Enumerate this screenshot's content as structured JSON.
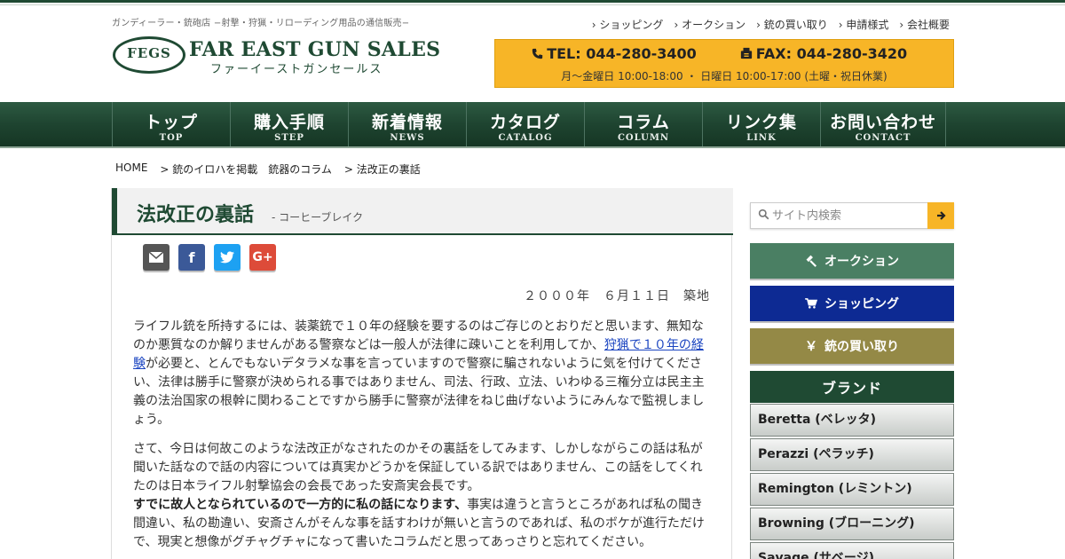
{
  "header": {
    "tagline": "ガンディーラー・銃砲店 −射撃・狩猟・リローディング用品の通信販売−",
    "logo_emblem": "FEGS",
    "logo_en": "FAR EAST GUN SALES",
    "logo_ja": "ファーイーストガンセールス",
    "util_nav": [
      "ショッピング",
      "オークション",
      "銃の買い取り",
      "申請様式",
      "会社概要"
    ],
    "tel": "TEL: 044-280-3400",
    "fax": "FAX: 044-280-3420",
    "hours": "月〜金曜日 10:00-18:00 ・ 日曜日 10:00-17:00 (土曜・祝日休業)"
  },
  "gnav": [
    {
      "ja": "トップ",
      "en": "TOP"
    },
    {
      "ja": "購入手順",
      "en": "STEP"
    },
    {
      "ja": "新着情報",
      "en": "NEWS"
    },
    {
      "ja": "カタログ",
      "en": "CATALOG"
    },
    {
      "ja": "コラム",
      "en": "COLUMN"
    },
    {
      "ja": "リンク集",
      "en": "LINK"
    },
    {
      "ja": "お問い合わせ",
      "en": "CONTACT"
    }
  ],
  "breadcrumb": [
    "HOME",
    "> 銃のイロハを掲載　銃器のコラム",
    "> 法改正の裏話"
  ],
  "article": {
    "title": "法改正の裏話",
    "subtitle": "- コーヒーブレイク",
    "date": "２０００年　６月１１日　築地",
    "p1_before": "ライフル銃を所持するには、装薬銃で１０年の経験を要するのはご存じのとおりだと思います、無知なのか悪質なのか解りませんがある警察などは一般人が法律に疎いことを利用してか、",
    "p1_link": "狩猟で１０年の経験",
    "p1_after": "が必要と、とんでもないデタラメな事を言っていますので警察に騙されないように気を付けてください、法律は勝手に警察が決められる事ではありません、司法、行政、立法、いわゆる三権分立は民主主義の法治国家の根幹に関わることですから勝手に警察が法律をねじ曲げないようにみんなで監視しましょう。",
    "p2": "さて、今日は何故このような法改正がなされたのかその裏話をしてみます、しかしながらこの話は私が聞いた話なので話の内容については真実かどうかを保証している訳ではありません、この話をしてくれたのは日本ライフル射撃協会の会長であった安斎実会長です。",
    "p3_bold": "すでに故人となられているので一方的に私の話になります、",
    "p3_rest": "事実は違うと言うところがあれば私の聞き間違い、私の勘違い、安斎さんがそんな事を話すわけが無いと言うのであれば、私のボケが進行ただけで、現実と想像がグチャグチャになって書いたコラムだと思ってあっさりと忘れてください。"
  },
  "sidebar": {
    "search_placeholder": "サイト内検索",
    "btn_auction": "オークション",
    "btn_shop": "ショッピング",
    "btn_buy": "銃の買い取り",
    "yen": "￥",
    "brand_title": "ブランド",
    "brands": [
      "Beretta (ベレッタ)",
      "Perazzi (ペラッチ)",
      "Remington (レミントン)",
      "Browning (ブローニング)",
      "Savage (サベージ)"
    ]
  },
  "colors": {
    "brand_green": "#1f4a33",
    "accent_orange": "#f7b527",
    "auction_green": "#4a7f63",
    "shop_blue": "#0d2a93",
    "buy_olive": "#948946",
    "link_blue": "#1a44c0"
  },
  "icons": {
    "phone": "phone-icon",
    "fax": "fax-icon",
    "search": "search-icon",
    "arrow": "arrow-right-icon",
    "hammer": "gavel-icon",
    "cart": "cart-icon",
    "mail": "envelope-icon",
    "facebook": "facebook-icon",
    "twitter": "twitter-icon",
    "gplus": "google-plus-icon"
  }
}
